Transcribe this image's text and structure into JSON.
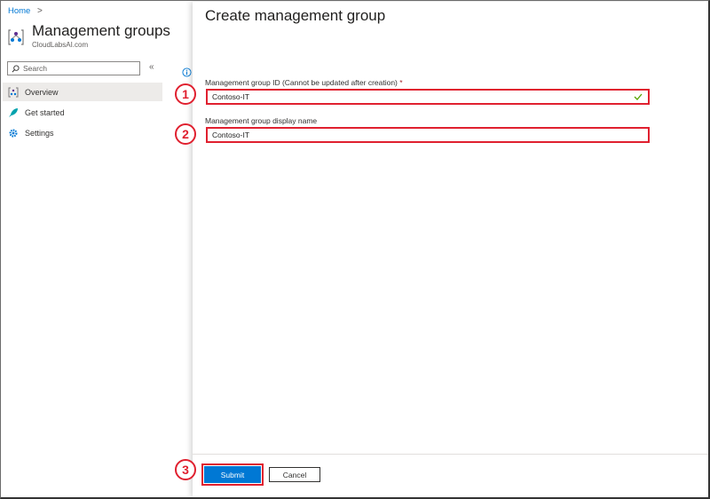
{
  "breadcrumb": {
    "home": "Home",
    "separator": ">"
  },
  "blade": {
    "title": "Management groups",
    "subtitle": "CloudLabsAI.com",
    "search_placeholder": "Search",
    "collapse_glyph": "«",
    "nav": [
      {
        "label": "Overview",
        "icon": "overview-icon"
      },
      {
        "label": "Get started",
        "icon": "rocket-icon"
      },
      {
        "label": "Settings",
        "icon": "gear-icon"
      }
    ]
  },
  "panel": {
    "title": "Create management group",
    "id_field": {
      "label": "Management group ID (Cannot be updated after creation)",
      "required_mark": "*",
      "value": "Contoso-IT"
    },
    "name_field": {
      "label": "Management group display name",
      "value": "Contoso-IT"
    },
    "submit_label": "Submit",
    "cancel_label": "Cancel"
  },
  "callouts": [
    "1",
    "2",
    "3"
  ],
  "colors": {
    "accent": "#0078d4",
    "highlight": "#e0202f",
    "valid": "#57a300"
  }
}
